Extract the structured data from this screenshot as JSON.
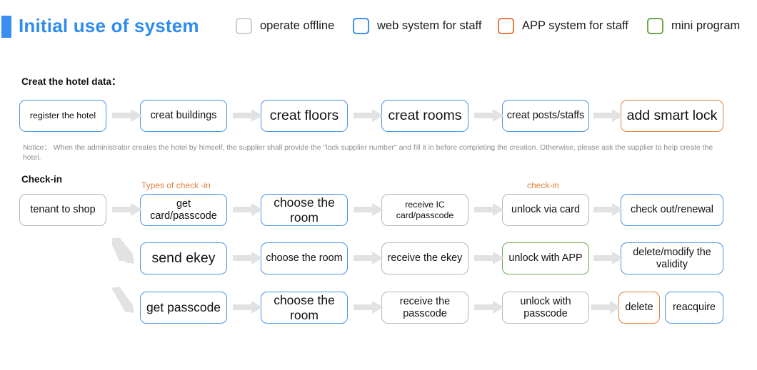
{
  "header": {
    "title": "Initial use of system",
    "accent_color": "#3a8ef0",
    "legend": [
      {
        "label": "operate offline",
        "color": "#cfcfcf",
        "style": "gray"
      },
      {
        "label": "web system for staff",
        "color": "#3c90e8",
        "style": "blue"
      },
      {
        "label": "APP system for staff",
        "color": "#e27f3e",
        "style": "orange"
      },
      {
        "label": "mini program",
        "color": "#6aaa4a",
        "style": "green"
      }
    ]
  },
  "sections": {
    "hotel_title": "Creat the hotel data：",
    "checkin_title": "Check-in"
  },
  "notice": {
    "text": "Notice：  When the administrator creates the hotel by himself, the supplier shall provide the \"lock supplier number\" and fill it in before completing the creation. Otherwise, please ask the supplier to help create the hotel."
  },
  "captions": {
    "types_of_checkin": "Types of check -in",
    "checkin": "check-in"
  },
  "hotel_flow": [
    {
      "label": "register the hotel",
      "style": "blue",
      "size": "sm"
    },
    {
      "label": "creat buildings",
      "style": "blue",
      "size": "md"
    },
    {
      "label": "creat floors",
      "style": "blue",
      "size": "xl"
    },
    {
      "label": "creat rooms",
      "style": "blue",
      "size": "xl"
    },
    {
      "label": "creat posts/staffs",
      "style": "blue",
      "size": "md"
    },
    {
      "label": "add smart lock",
      "style": "orange",
      "size": "xl"
    }
  ],
  "checkin_start": {
    "label": "tenant to shop",
    "style": "gray",
    "size": "md"
  },
  "checkin_rows": [
    [
      {
        "label": "get card/passcode",
        "style": "blue",
        "size": "md"
      },
      {
        "label": "choose the room",
        "style": "blue",
        "size": "lg"
      },
      {
        "label": "receive IC card/passcode",
        "style": "gray",
        "size": "sm"
      },
      {
        "label": "unlock via card",
        "style": "gray",
        "size": "md"
      },
      {
        "label": "check out/renewal",
        "style": "blue",
        "size": "md"
      }
    ],
    [
      {
        "label": "send ekey",
        "style": "blue",
        "size": "xl"
      },
      {
        "label": "choose the room",
        "style": "blue",
        "size": "md"
      },
      {
        "label": "receive the ekey",
        "style": "gray",
        "size": "md"
      },
      {
        "label": "unlock with APP",
        "style": "green",
        "size": "md"
      },
      {
        "label": "delete/modify the validity",
        "style": "blue",
        "size": "md"
      }
    ],
    [
      {
        "label": "get passcode",
        "style": "blue",
        "size": "lg"
      },
      {
        "label": "choose the room",
        "style": "blue",
        "size": "lg"
      },
      {
        "label": "receive the passcode",
        "style": "gray",
        "size": "md"
      },
      {
        "label": "unlock with passcode",
        "style": "gray",
        "size": "md"
      },
      {
        "label": "delete",
        "style": "orange",
        "size": "md"
      },
      {
        "label": "reacquire",
        "style": "blue",
        "size": "md"
      }
    ]
  ],
  "colors": {
    "blue": "#4a95e2",
    "orange": "#e0803c",
    "green": "#6faa4d",
    "gray": "#b7b7b7",
    "arrow": "#e2e2e2",
    "title_blue": "#2e8ced",
    "notice_gray": "#8d8d8d"
  }
}
